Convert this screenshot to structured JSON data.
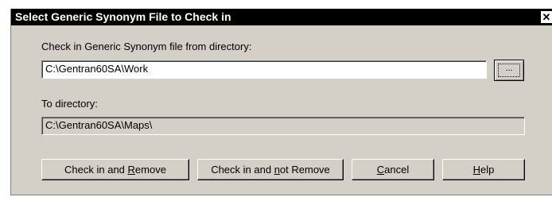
{
  "dialog": {
    "title": "Select Generic Synonym File to Check in",
    "close_glyph": "✕",
    "from_label": "Check in Generic Synonym file from directory:",
    "from_value": "C:\\Gentran60SA\\Work",
    "browse_label": "...",
    "to_label": "To directory:",
    "to_value": "C:\\Gentran60SA\\Maps\\"
  },
  "buttons": {
    "check_in_remove": {
      "pre": "Check in and ",
      "accel": "R",
      "post": "emove"
    },
    "check_in_not_remove": {
      "pre": "Check in and ",
      "accel": "n",
      "post": "ot Remove"
    },
    "cancel": {
      "pre": "",
      "accel": "C",
      "post": "ancel"
    },
    "help": {
      "pre": "",
      "accel": "H",
      "post": "elp"
    }
  }
}
